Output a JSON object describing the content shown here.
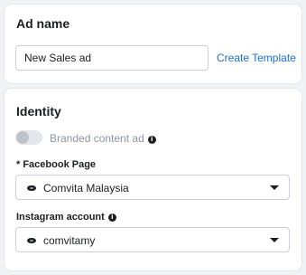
{
  "ad_name_section": {
    "title": "Ad name",
    "input_value": "New Sales ad",
    "create_template_label": "Create Template"
  },
  "identity_section": {
    "title": "Identity",
    "branded_content": {
      "label": "Branded content ad",
      "enabled": false
    },
    "facebook_page": {
      "label": "* Facebook Page",
      "selected": "Comvita Malaysia"
    },
    "instagram_account": {
      "label": "Instagram account",
      "selected": "comvitamy"
    }
  },
  "icons": {
    "info": "i"
  },
  "colors": {
    "link": "#216fdb",
    "background": "#f0f2f5"
  }
}
